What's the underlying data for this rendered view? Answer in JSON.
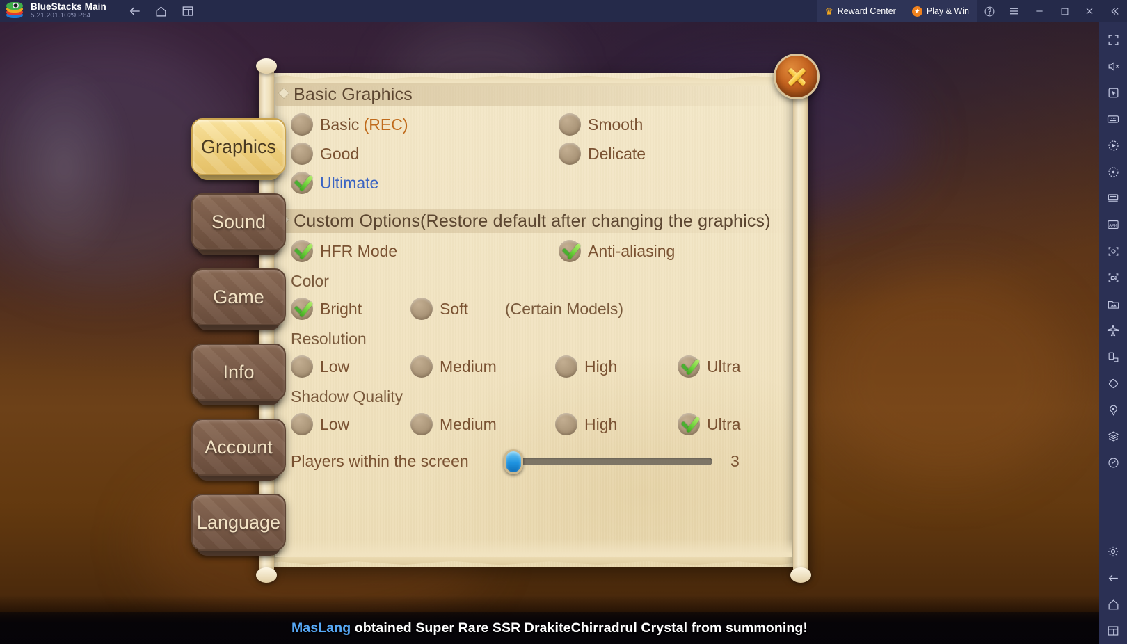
{
  "titlebar": {
    "app_name": "BlueStacks Main",
    "version": "5.21.201.1029 P64",
    "nav": [
      {
        "name": "back",
        "glyph": "back-arrow-icon"
      },
      {
        "name": "home",
        "glyph": "home-icon"
      },
      {
        "name": "multi-instance",
        "glyph": "windows-icon"
      }
    ],
    "reward_center": "Reward Center",
    "play_and_win": "Play & Win",
    "help_label": "?",
    "menu_label": "Menu",
    "minimize_label": "Minimize",
    "maximize_label": "Maximize",
    "close_label": "Close",
    "collapse_label": "Collapse"
  },
  "rail": {
    "icons": [
      "fullscreen-icon",
      "mute-icon",
      "cursor-icon",
      "keyboard-controls-icon",
      "macro-record-icon",
      "script-icon",
      "multi-instance-manager-icon",
      "install-apk-icon",
      "screenshot-icon",
      "record-video-icon",
      "media-manager-icon",
      "plane-icon",
      "rotate-screen-icon",
      "tilt-icon",
      "location-icon",
      "layers-icon",
      "performance-icon"
    ],
    "bottom_icons": [
      "gear-icon",
      "back-arrow-icon",
      "home-icon",
      "windows-icon"
    ]
  },
  "settings": {
    "tabs": [
      {
        "label": "Graphics",
        "active": true
      },
      {
        "label": "Sound",
        "active": false
      },
      {
        "label": "Game",
        "active": false
      },
      {
        "label": "Info",
        "active": false
      },
      {
        "label": "Account",
        "active": false
      },
      {
        "label": "Language",
        "active": false
      }
    ],
    "close_button": "Close",
    "sections": {
      "basic_graphics": {
        "title": "Basic Graphics",
        "options": [
          {
            "label": "Basic ",
            "suffix": "(REC)",
            "checked": false,
            "col": "left"
          },
          {
            "label": "Smooth",
            "suffix": "",
            "checked": false,
            "col": "right"
          },
          {
            "label": "Good",
            "suffix": "",
            "checked": false,
            "col": "left"
          },
          {
            "label": "Delicate",
            "suffix": "",
            "checked": false,
            "col": "right"
          },
          {
            "label": "Ultimate",
            "suffix": "",
            "checked": true,
            "col": "left"
          }
        ]
      },
      "custom_options": {
        "title": "Custom Options(Restore default after changing the graphics)",
        "toggles": [
          {
            "label": "HFR Mode",
            "checked": true
          },
          {
            "label": "Anti-aliasing",
            "checked": true
          }
        ],
        "color": {
          "title": "Color",
          "options": [
            {
              "label": "Bright",
              "checked": true
            },
            {
              "label": "Soft",
              "checked": false
            }
          ],
          "note": "(Certain Models)"
        },
        "resolution": {
          "title": "Resolution",
          "options": [
            {
              "label": "Low",
              "checked": false
            },
            {
              "label": "Medium",
              "checked": false
            },
            {
              "label": "High",
              "checked": false
            },
            {
              "label": "Ultra",
              "checked": true
            }
          ]
        },
        "shadow_quality": {
          "title": "Shadow Quality",
          "options": [
            {
              "label": "Low",
              "checked": false
            },
            {
              "label": "Medium",
              "checked": false
            },
            {
              "label": "High",
              "checked": false
            },
            {
              "label": "Ultra",
              "checked": true
            }
          ]
        },
        "players_slider": {
          "label": "Players within the screen",
          "value": "3",
          "percent": 3
        }
      }
    }
  },
  "announcement": {
    "player": "MasLang",
    "message": " obtained Super Rare SSR DrakiteChirradrul Crystal  from summoning!"
  },
  "colors": {
    "titlebar_bg": "#252a4a",
    "rail_bg": "#2b3054",
    "paper": "#f1e3c0",
    "accent_orange": "#f0821e",
    "tab_active": "#f0d280",
    "checkmark_green": "#6ed23c",
    "slider_blue": "#1e93e0",
    "player_name_blue": "#57a8f5"
  }
}
